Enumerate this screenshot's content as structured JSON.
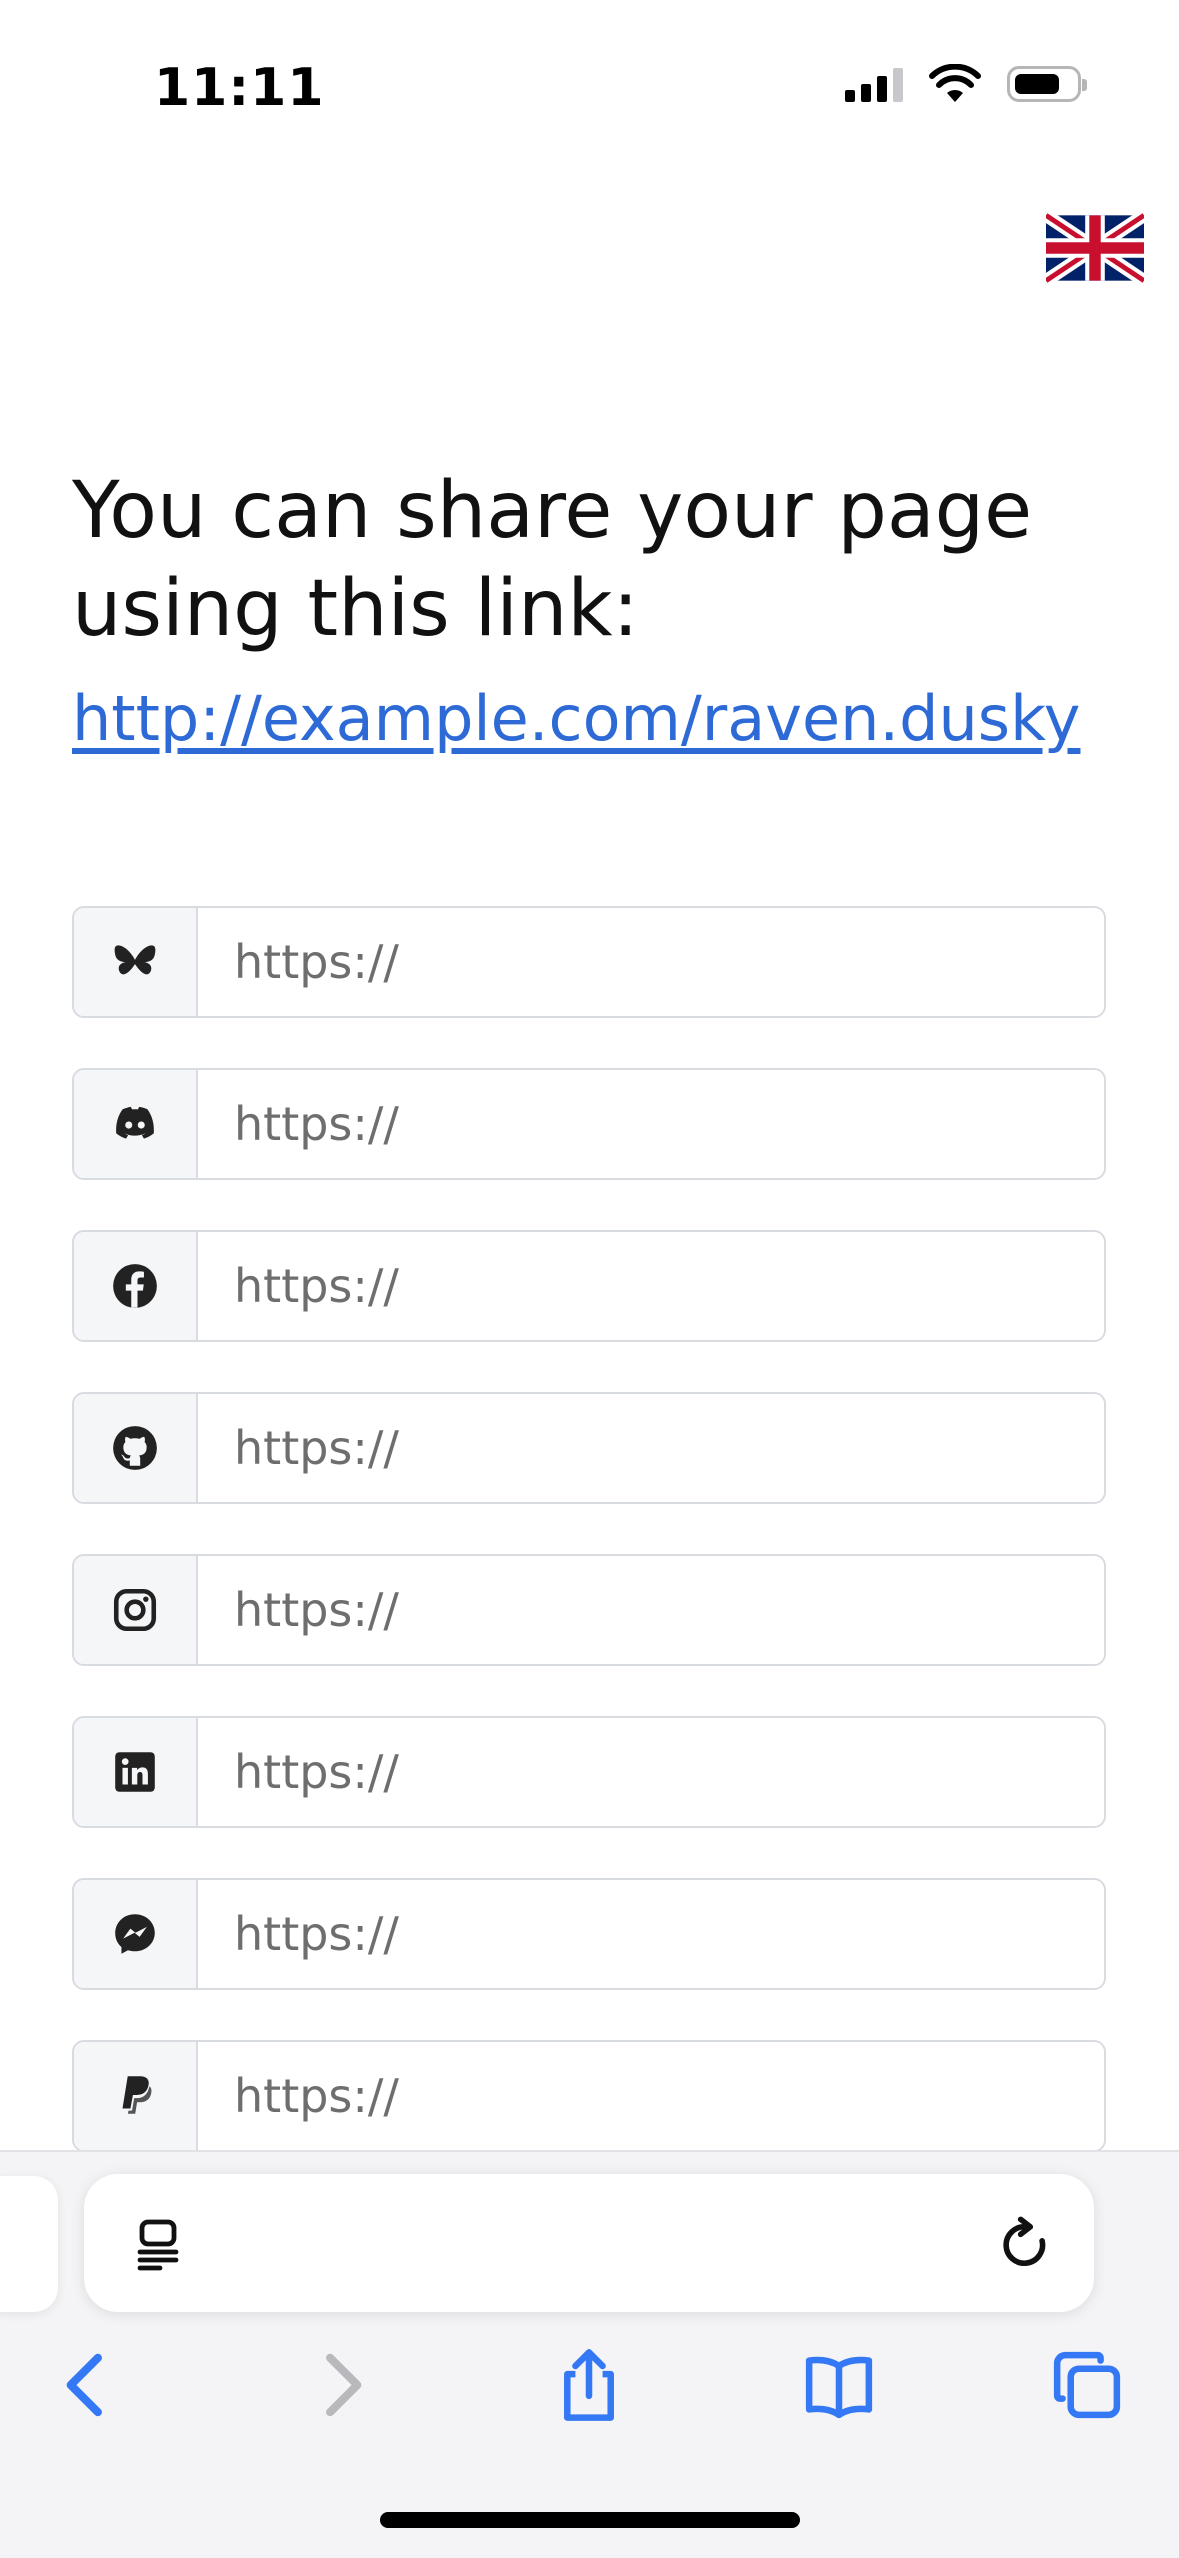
{
  "status_bar": {
    "time": "11:11"
  },
  "language": {
    "flag": "uk-flag-icon"
  },
  "share": {
    "heading": "You can share your page using this link:",
    "link": "http://example.com/raven.dusky"
  },
  "social_links": [
    {
      "icon": "bluesky-icon",
      "placeholder": "https://",
      "value": ""
    },
    {
      "icon": "discord-icon",
      "placeholder": "https://",
      "value": ""
    },
    {
      "icon": "facebook-icon",
      "placeholder": "https://",
      "value": ""
    },
    {
      "icon": "github-icon",
      "placeholder": "https://",
      "value": ""
    },
    {
      "icon": "instagram-icon",
      "placeholder": "https://",
      "value": ""
    },
    {
      "icon": "linkedin-icon",
      "placeholder": "https://",
      "value": ""
    },
    {
      "icon": "messenger-icon",
      "placeholder": "https://",
      "value": ""
    },
    {
      "icon": "paypal-icon",
      "placeholder": "https://",
      "value": ""
    }
  ],
  "browser": {
    "toolbar": [
      "back-icon",
      "forward-icon",
      "share-icon",
      "bookmarks-icon",
      "tabs-icon"
    ]
  },
  "colors": {
    "link": "#2e6ad6",
    "toolbar_accent": "#3478f6",
    "disabled": "#b8b8bd"
  }
}
